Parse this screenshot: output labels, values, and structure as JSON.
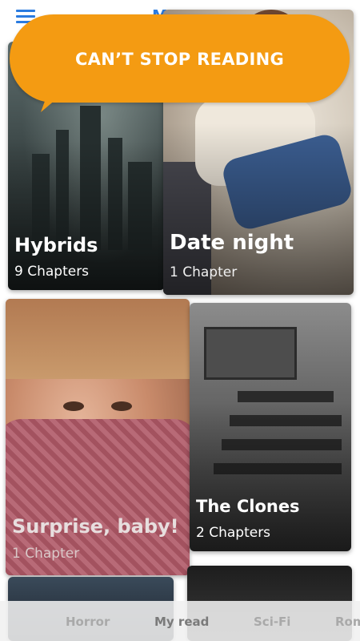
{
  "header": {
    "app_title": "M"
  },
  "banner": {
    "text": "CAN’T STOP READING"
  },
  "stories": [
    {
      "title": "Hybrids",
      "chapters": "9 Chapters"
    },
    {
      "title": "Date night",
      "chapters": "1 Chapter"
    },
    {
      "title": "Surprise, baby!",
      "chapters": "1 Chapter"
    },
    {
      "title": "The Clones",
      "chapters": "2 Chapters"
    }
  ],
  "bottom_nav": {
    "tabs": [
      {
        "label": "Horror"
      },
      {
        "label": "My read"
      },
      {
        "label": "Sci-Fi"
      },
      {
        "label": "Rom"
      }
    ],
    "active": "My read"
  },
  "colors": {
    "accent": "#2a7be0",
    "banner": "#f49b12"
  },
  "icons": {
    "menu": "hamburger-menu-icon"
  }
}
